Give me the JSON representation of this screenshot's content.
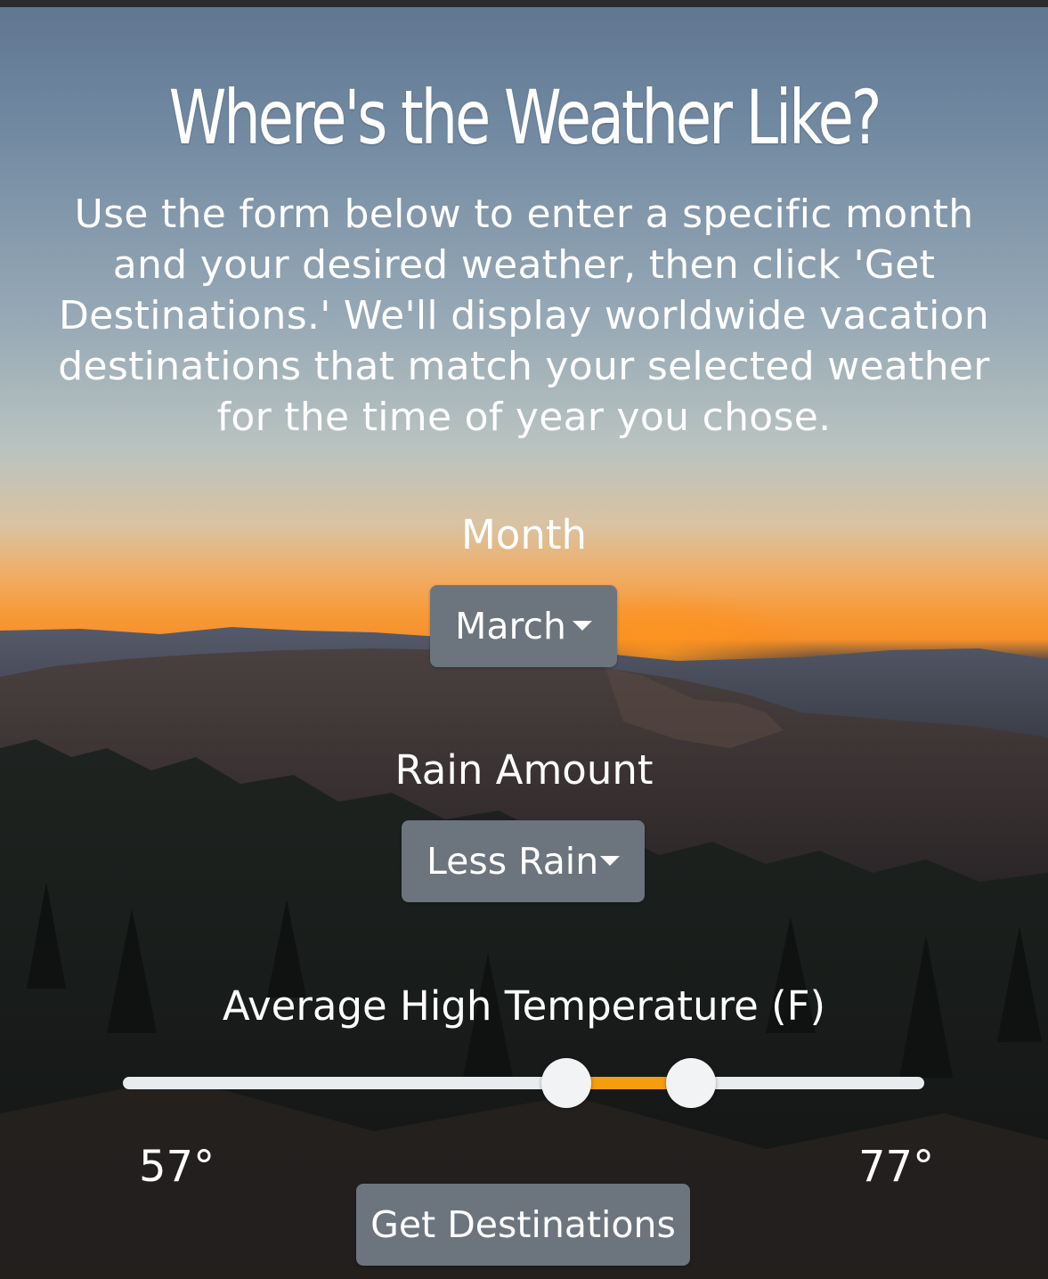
{
  "header": {
    "title": "Where's the Weather Like?",
    "intro": "Use the form below to enter a specific month and your desired weather, then click 'Get Destinations.' We'll display worldwide vacation destinations that match your selected weather for the time of year you chose."
  },
  "form": {
    "month": {
      "label": "Month",
      "selected": "March"
    },
    "rain": {
      "label": "Rain Amount",
      "selected": "Less Rain"
    },
    "temperature": {
      "label": "Average High Temperature (F)",
      "min_label": "57°",
      "max_label": "77°",
      "selected_low_fraction": 0.553,
      "selected_high_fraction": 0.709
    },
    "submit_label": "Get Destinations"
  },
  "colors": {
    "button": "#6c757d",
    "slider_track": "#e9ecef",
    "slider_range": "#f59d0e",
    "slider_thumb": "#f1f3f5",
    "text": "#ffffff"
  },
  "icons": {
    "dropdown": "caret-down-icon"
  }
}
